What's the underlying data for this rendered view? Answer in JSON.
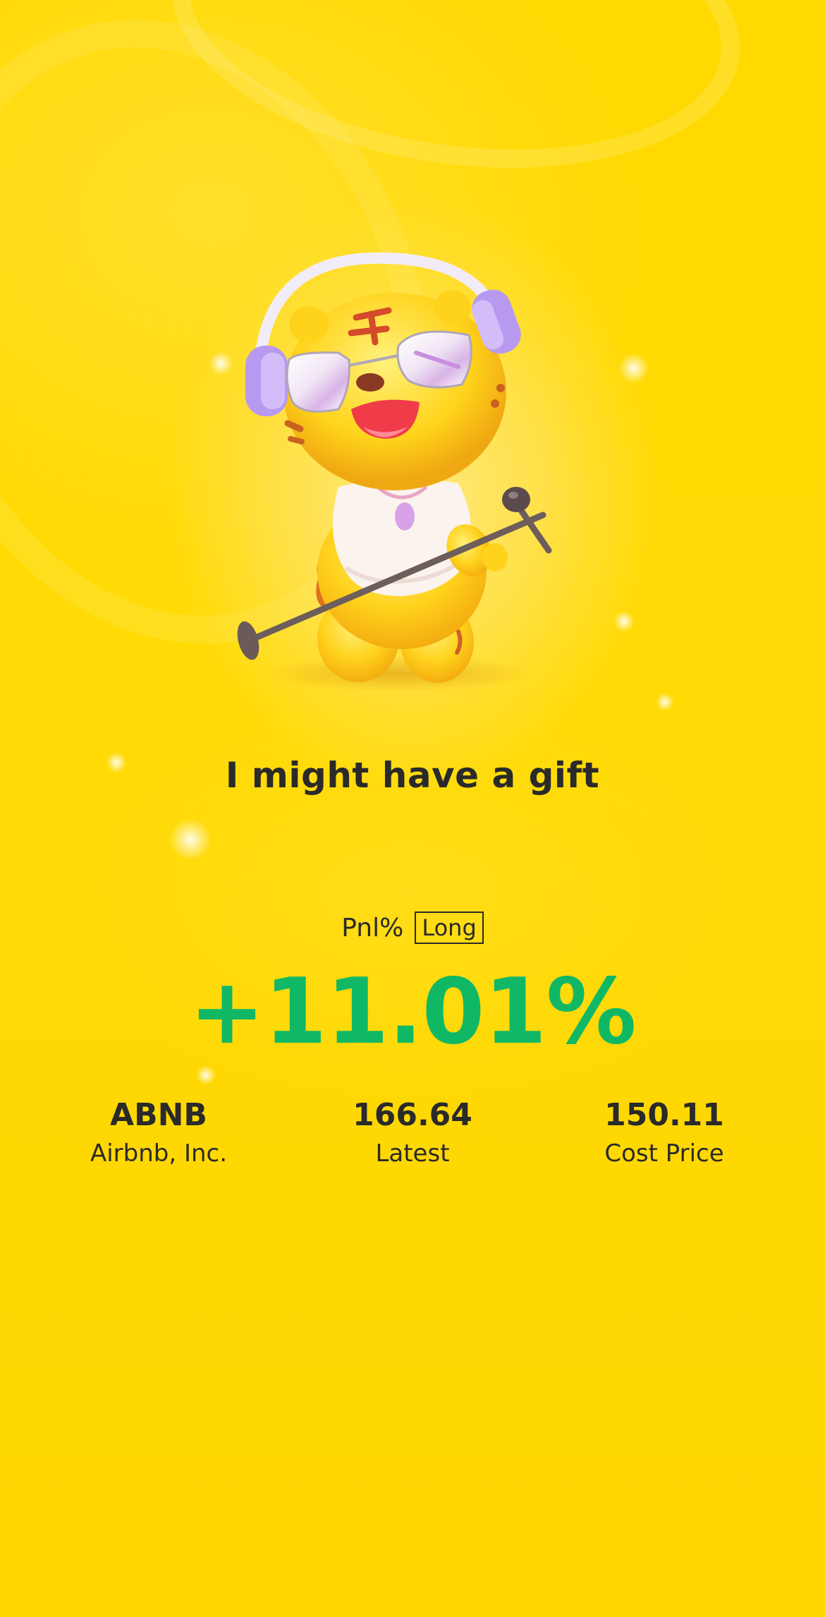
{
  "colors": {
    "background": "#ffd900",
    "text": "#2a2a2a",
    "gain": "#10b866"
  },
  "illustration": {
    "icon": "tiger-mascot-with-headphones-and-microphone"
  },
  "tagline": "I might have a gift",
  "pnl": {
    "label": "Pnl%",
    "side": "Long",
    "value": "+11.01%"
  },
  "stats": [
    {
      "value": "ABNB",
      "label": "Airbnb, Inc."
    },
    {
      "value": "166.64",
      "label": "Latest"
    },
    {
      "value": "150.11",
      "label": "Cost Price"
    }
  ]
}
